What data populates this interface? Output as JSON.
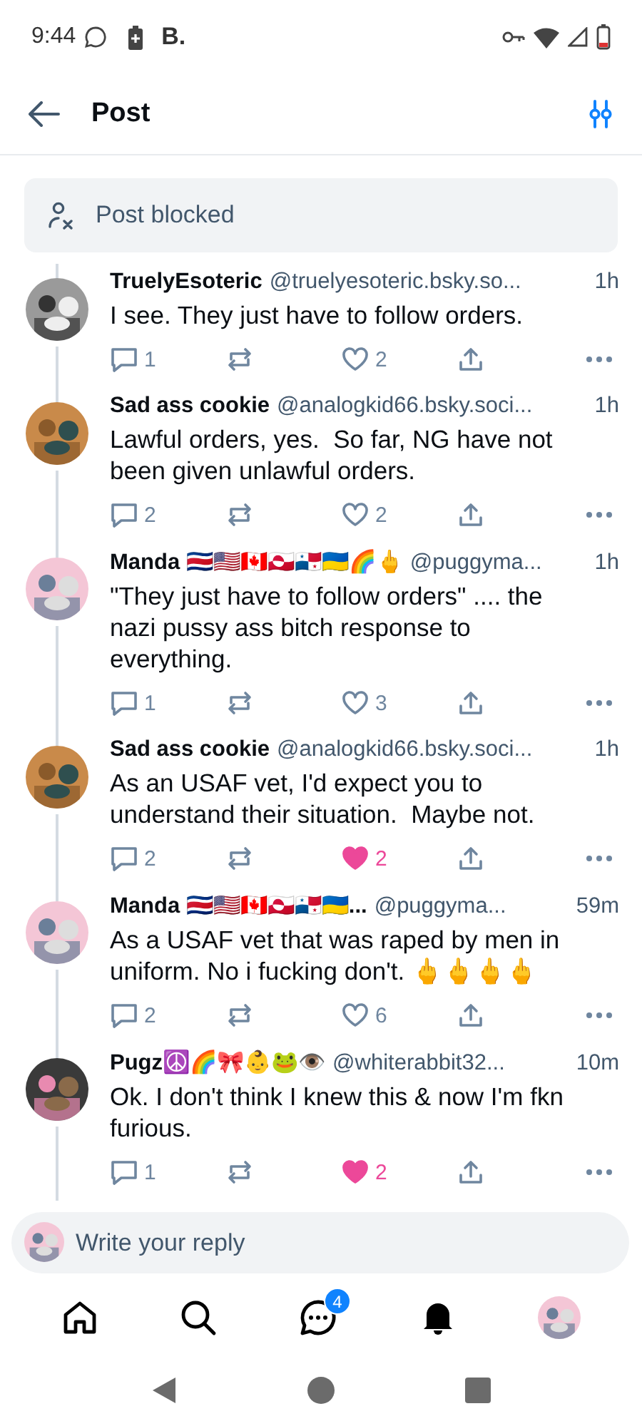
{
  "status_bar": {
    "time": "9:44",
    "app_letter": "B."
  },
  "header": {
    "title": "Post"
  },
  "blocked_notice": {
    "label": "Post blocked"
  },
  "replies": [
    {
      "name": "TruelyEsoteric",
      "handle": "@truelyesoteric.bsky.so...",
      "time": "1h",
      "text": "I see. They just have to follow orders.",
      "reply_count": "1",
      "like_count": "2",
      "liked": false
    },
    {
      "name": "Sad ass cookie",
      "handle": "@analogkid66.bsky.soci...",
      "time": "1h",
      "text": "Lawful orders, yes.  So far, NG have not been given unlawful orders.",
      "reply_count": "2",
      "like_count": "2",
      "liked": false
    },
    {
      "name": "Manda 🇨🇷🇺🇸🇨🇦🇬🇱🇵🇦🇺🇦🌈🖕",
      "handle": "@puggyma...",
      "time": "1h",
      "text": "\"They just have to follow orders\" .... the nazi pussy ass bitch response to everything.",
      "reply_count": "1",
      "like_count": "3",
      "liked": false
    },
    {
      "name": "Sad ass cookie",
      "handle": "@analogkid66.bsky.soci...",
      "time": "1h",
      "text": "As an USAF vet, I'd expect you to understand their situation.  Maybe not.",
      "reply_count": "2",
      "like_count": "2",
      "liked": true
    },
    {
      "name": "Manda 🇨🇷🇺🇸🇨🇦🇬🇱🇵🇦🇺🇦...",
      "handle": "@puggyma...",
      "time": "59m",
      "text": "As a USAF vet that was raped by men in uniform. No i fucking don't. 🖕🖕🖕🖕",
      "reply_count": "2",
      "like_count": "6",
      "liked": false
    },
    {
      "name": "Pugz☮️🌈🎀👶🐸👁️",
      "handle": "@whiterabbit32...",
      "time": "10m",
      "text": "Ok. I don't think I knew this & now I'm fkn furious.",
      "reply_count": "1",
      "like_count": "2",
      "liked": true
    }
  ],
  "composer": {
    "placeholder": "Write your reply"
  },
  "tab_bar": {
    "messages_badge": "4"
  }
}
